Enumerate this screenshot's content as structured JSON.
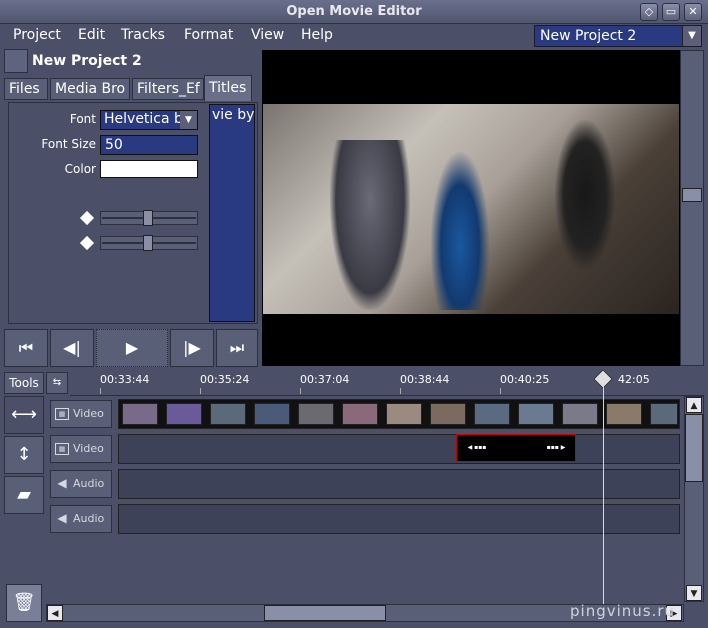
{
  "window": {
    "title": "Open Movie Editor",
    "controls": [
      "◇",
      "▭",
      "✕"
    ]
  },
  "menu": [
    "Project",
    "Edit",
    "Tracks",
    "Format",
    "View",
    "Help"
  ],
  "project_select": {
    "value": "New Project 2",
    "arrow": "▼"
  },
  "project_name": "New Project 2",
  "tabs": [
    "Files",
    "Media Bro",
    "Filters_Ef",
    "Titles"
  ],
  "titles_panel": {
    "font_label": "Font",
    "font_value": "Helvetica b",
    "font_size_label": "Font Size",
    "font_size_value": "50",
    "color_label": "Color",
    "text_preview": "vie by"
  },
  "transport": [
    "⏮",
    "◀|",
    "▶",
    "|▶",
    "⏭"
  ],
  "tools_label": "Tools",
  "ruler_ticks": [
    "00:33:44",
    "00:35:24",
    "00:37:04",
    "00:38:44",
    "00:40:25",
    "42:05"
  ],
  "tracks": [
    {
      "type": "Video"
    },
    {
      "type": "Video"
    },
    {
      "type": "Audio"
    },
    {
      "type": "Audio"
    }
  ],
  "watermark": "pingvinus.ru"
}
